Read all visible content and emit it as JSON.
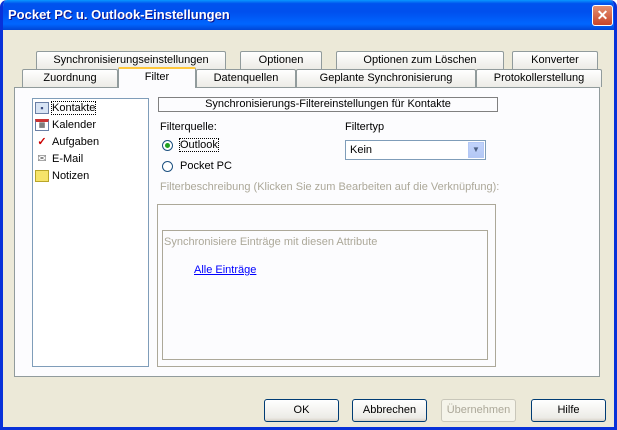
{
  "window": {
    "title": "Pocket PC u. Outlook-Einstellungen",
    "close_glyph": "✕"
  },
  "tabs_back": [
    "Synchronisierungseinstellungen",
    "Optionen",
    "Optionen zum Löschen",
    "Konverter"
  ],
  "tabs_front": [
    "Zuordnung",
    "Filter",
    "Datenquellen",
    "Geplante Synchronisierung",
    "Protokollerstellung"
  ],
  "active_tab": "Filter",
  "sidebar": {
    "items": [
      {
        "label": "Kontakte",
        "icon": "contact-card-icon",
        "selected": true
      },
      {
        "label": "Kalender",
        "icon": "calendar-icon",
        "selected": false
      },
      {
        "label": "Aufgaben",
        "icon": "task-checkmark-icon",
        "selected": false
      },
      {
        "label": "E-Mail",
        "icon": "envelope-icon",
        "selected": false
      },
      {
        "label": "Notizen",
        "icon": "note-icon",
        "selected": false
      }
    ]
  },
  "filter": {
    "group_title": "Synchronisierungs-Filtereinstellungen für Kontakte",
    "source_label": "Filterquelle:",
    "source_options": [
      "Outlook",
      "Pocket PC"
    ],
    "source_selected": "Outlook",
    "type_label": "Filtertyp",
    "type_value": "Kein",
    "description_label": "Filterbeschreibung (Klicken Sie zum Bearbeiten auf die Verknüpfung):",
    "description_heading": "Synchronisiere Einträge mit diesen Attribute",
    "description_link": "Alle Einträge"
  },
  "buttons": {
    "ok": "OK",
    "cancel": "Abbrechen",
    "apply": "Übernehmen",
    "help": "Hilfe"
  },
  "colors": {
    "titlebar": "#0054e3",
    "face": "#ece9d8",
    "active_tab_highlight": "#ffc83c",
    "link": "#0000ff",
    "radio_dot": "#21a121"
  }
}
